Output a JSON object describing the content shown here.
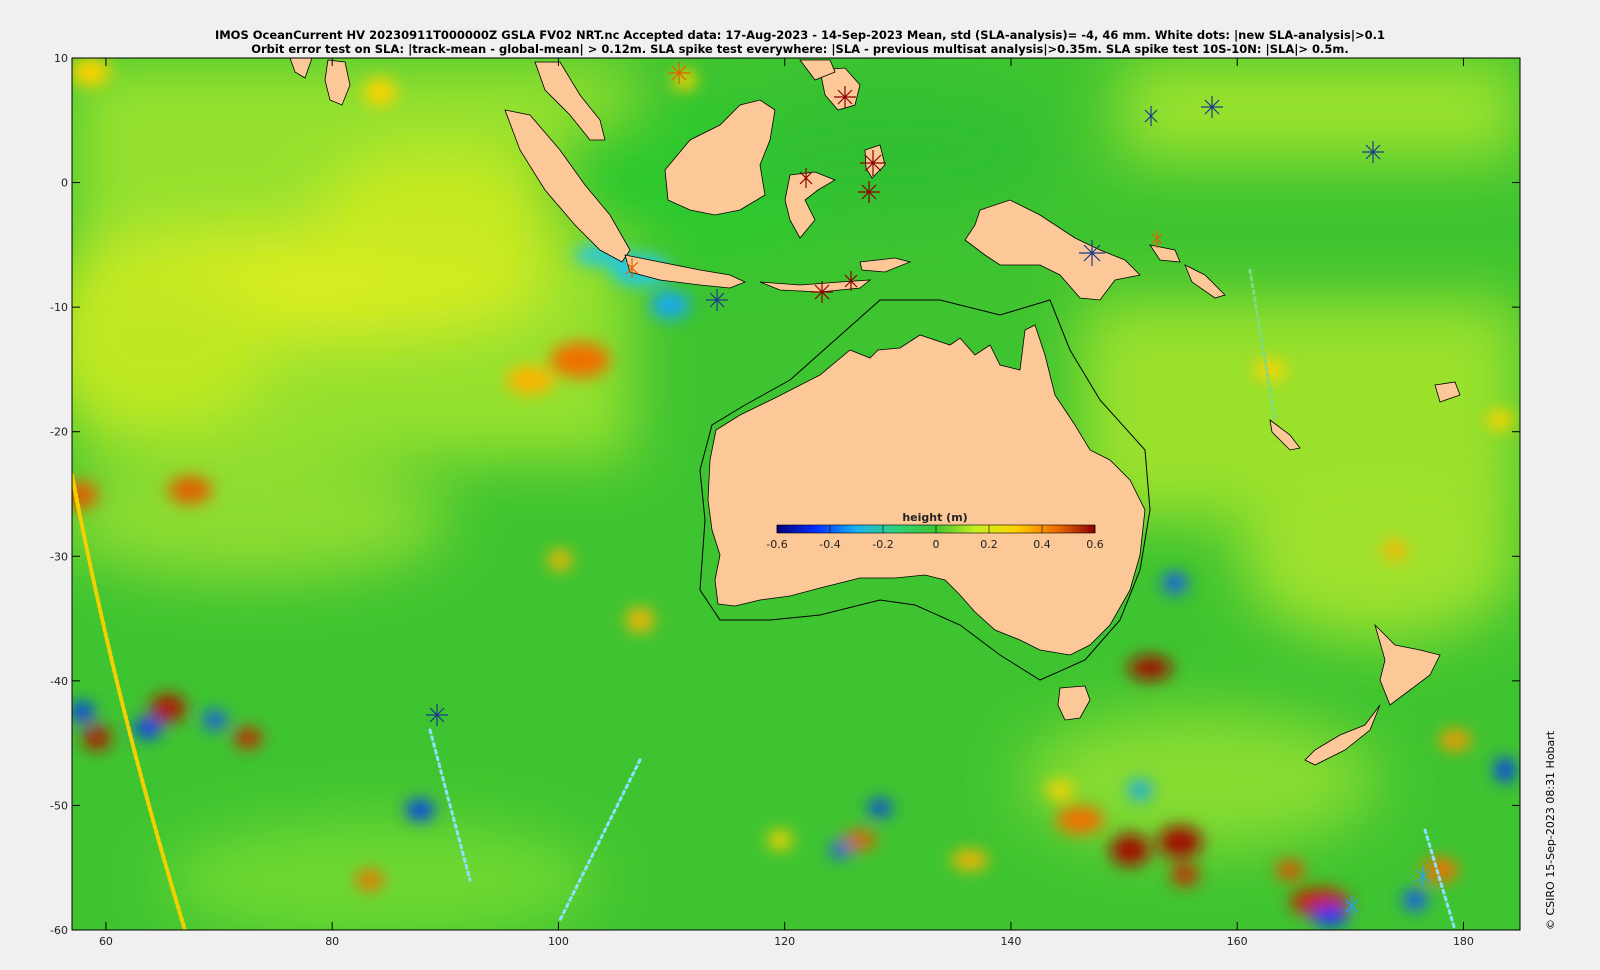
{
  "title": {
    "line1": "IMOS OceanCurrent HV 20230911T000000Z GSLA FV02 NRT.nc  Accepted data: 17-Aug-2023 - 14-Sep-2023 Mean, std (SLA-analysis)= -4, 46 mm. White dots: |new SLA-analysis|>0.1",
    "line2": "Orbit error test on SLA: |track-mean  - global-mean| > 0.12m.  SLA spike test everywhere: |SLA - previous multisat analysis|>0.35m. SLA spike test 10S-10N: |SLA|> 0.5m."
  },
  "credit": "© CSIRO 15-Sep-2023 08:31 Hobart",
  "colorbar": {
    "label": "height (m)",
    "ticks": [
      "-0.6",
      "-0.4",
      "-0.2",
      "0",
      "0.2",
      "0.4",
      "0.6"
    ]
  },
  "axes": {
    "x_ticks": [
      "60",
      "80",
      "100",
      "120",
      "140",
      "160",
      "180"
    ],
    "y_ticks": [
      "10",
      "0",
      "-10",
      "-20",
      "-30",
      "-40",
      "-50",
      "-60"
    ]
  },
  "map": {
    "lon_range": [
      57,
      185
    ],
    "lat_range": [
      -60,
      10
    ],
    "land_color": "#fcc897",
    "ocean_base_color": "#3fc431",
    "regions": [
      "Australia",
      "Papua New Guinea",
      "New Zealand",
      "Sumatra",
      "Borneo",
      "Sulawesi",
      "Java",
      "Tasmania"
    ]
  }
}
